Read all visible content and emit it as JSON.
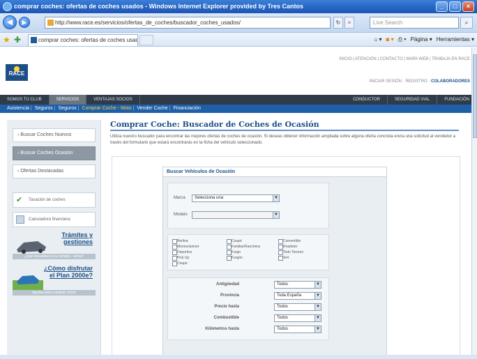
{
  "window": {
    "title": "comprar coches: ofertas de coches usados - Windows Internet Explorer provided by Tres Cantos",
    "minimize": "_",
    "maximize": "□",
    "close": "×"
  },
  "addressbar": {
    "url": "http://www.race.es/servicios/ofertas_de_coches/buscador_coches_usados/",
    "search_placeholder": "Live Search",
    "back": "◀",
    "forward": "▶",
    "refresh": "↻",
    "stop": "×",
    "search_go": "⌕"
  },
  "tabbar": {
    "tab_title": "comprar coches: ofertas de coches usados",
    "commands": [
      "Página ▾",
      "Herramientas ▾"
    ]
  },
  "site": {
    "logo": "RACE",
    "top_links": "INICIO | ATENCIÓN | CONTACTO | MAPA WEB | TRABAJA EN RACE",
    "top_links2_prefix": "INICIAR SESIÓN  ·  REGISTRO  ·  ",
    "top_links2_strong": "COLABORADORES",
    "main_nav": [
      "SOMOS TU CLUB",
      "SERVICIOS",
      "VENTAJAS SOCIOS",
      "CONDUCTOR",
      "SEGURIDAD VIAL",
      "FUNDACIÓN"
    ],
    "subnav": [
      "Asistencia",
      "Seguros",
      "Seguros",
      "Comprar Coche - Moto",
      "Vender Coche",
      "Financiación"
    ]
  },
  "sidebar": {
    "buttons": [
      "Buscar Coches Nuevos",
      "Buscar Coches Ocasión",
      "Ofertas Destacadas"
    ],
    "boxes": [
      "Tasación de coches",
      "Calculadora financiera"
    ],
    "promo1_title": "Trámites y gestiones",
    "promo1_sub": "¿Qué necesitas en tu compra - venta?",
    "promo2_title": "¿Cómo disfrutar el Plan 2000e?",
    "promo2_sub": "Ayudas para comprar coche"
  },
  "main": {
    "title": "Comprar Coche: Buscador de Coches de Ocasión",
    "intro": "Utiliza nuestro buscador para encontrar las mejores ofertas de coches de ocasión. Si deseas obtener información ampliada sobre alguna oferta concreta envía una solicitud al vendedor a través del formulario que estará encontrarás en la ficha del vehículo seleccionado.",
    "form_title": "Buscar Vehículos de Ocasión",
    "marca_label": "Marca",
    "marca_value": "Selecciona una",
    "modelo_label": "Modelo",
    "modelo_value": "",
    "body_types": [
      "Berlina",
      "Monovolumen",
      "Deportivo",
      "Pick Up",
      "Coupé",
      "Coupé",
      "Familiar/Ranchera",
      "Furgo",
      "Furgón",
      "Convertible",
      "Roadster",
      "Todo Terreno",
      "4x4"
    ],
    "filters": [
      {
        "label": "Antigüedad",
        "value": "Todos"
      },
      {
        "label": "Provincia",
        "value": "Toda España"
      },
      {
        "label": "Precio hasta",
        "value": "Todos"
      },
      {
        "label": "Combustible",
        "value": "Todos"
      },
      {
        "label": "Kilómetros hasta",
        "value": "Todos"
      }
    ]
  },
  "colors": {
    "title_bar": "#2563c4",
    "nav_dark": "#2f3b48",
    "subnav_blue": "#1e5fa8",
    "brand_blue": "#1d4f86"
  }
}
